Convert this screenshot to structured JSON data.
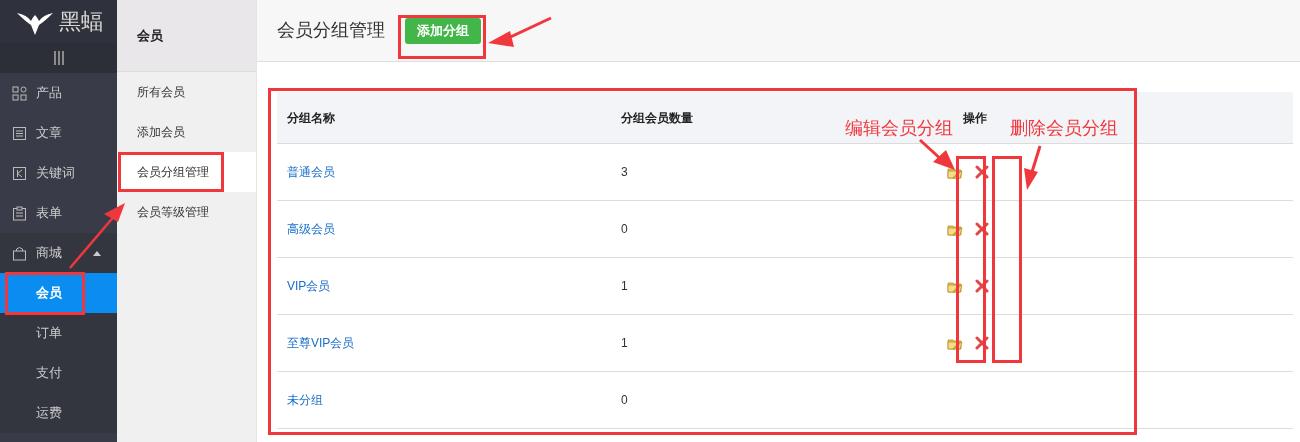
{
  "sidebar": {
    "logo": "黑蝠",
    "items": [
      {
        "label": "产品"
      },
      {
        "label": "文章"
      },
      {
        "label": "关键词"
      },
      {
        "label": "表单"
      },
      {
        "label": "商城",
        "expanded": true,
        "children": [
          {
            "label": "会员",
            "selected": true
          },
          {
            "label": "订单",
            "selected": false
          },
          {
            "label": "支付",
            "selected": false
          },
          {
            "label": "运费",
            "selected": false
          }
        ]
      }
    ]
  },
  "subnav": {
    "title": "会员",
    "items": [
      {
        "label": "所有会员",
        "selected": false
      },
      {
        "label": "添加会员",
        "selected": false
      },
      {
        "label": "会员分组管理",
        "selected": true
      },
      {
        "label": "会员等级管理",
        "selected": false
      }
    ]
  },
  "main": {
    "title": "会员分组管理",
    "add_button": "添加分组",
    "table": {
      "columns": [
        "分组名称",
        "分组会员数量",
        "操作"
      ],
      "rows": [
        {
          "name": "普通会员",
          "count": "3",
          "actions": true
        },
        {
          "name": "高级会员",
          "count": "0",
          "actions": true
        },
        {
          "name": "VIP会员",
          "count": "1",
          "actions": true
        },
        {
          "name": "至尊VIP会员",
          "count": "1",
          "actions": true
        },
        {
          "name": "未分组",
          "count": "0",
          "actions": false
        }
      ]
    }
  },
  "annotations": [
    "编辑会员分组",
    "删除会员分组"
  ]
}
